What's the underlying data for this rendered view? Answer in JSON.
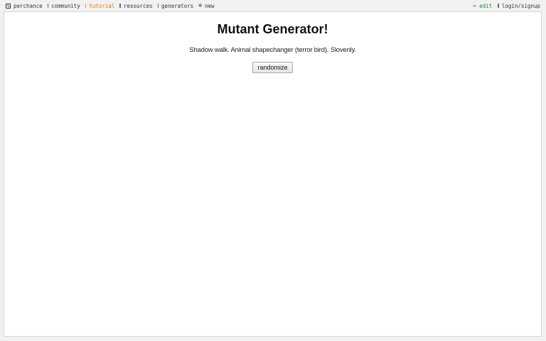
{
  "nav": {
    "brand": "perchance",
    "community": "community",
    "tutorial": "tutorial",
    "resources": "resources",
    "generators": "generators",
    "new": "new",
    "edit": "edit",
    "login": "login/signup"
  },
  "icons": {
    "brand": "dice-icon",
    "community": "bar-icon",
    "tutorial": "bar-icon",
    "resources": "bar-icon",
    "generators": "bar-icon",
    "new": "plus-circle-icon",
    "edit": "pencil-icon",
    "login": "bar-icon"
  },
  "colors": {
    "tutorial": "#e07b00",
    "edit": "#2e8b2e"
  },
  "main": {
    "title": "Mutant Generator!",
    "output": "Shadow walk. Animal shapechanger (terror bird). Slovenly.",
    "randomize_label": "randomize"
  }
}
